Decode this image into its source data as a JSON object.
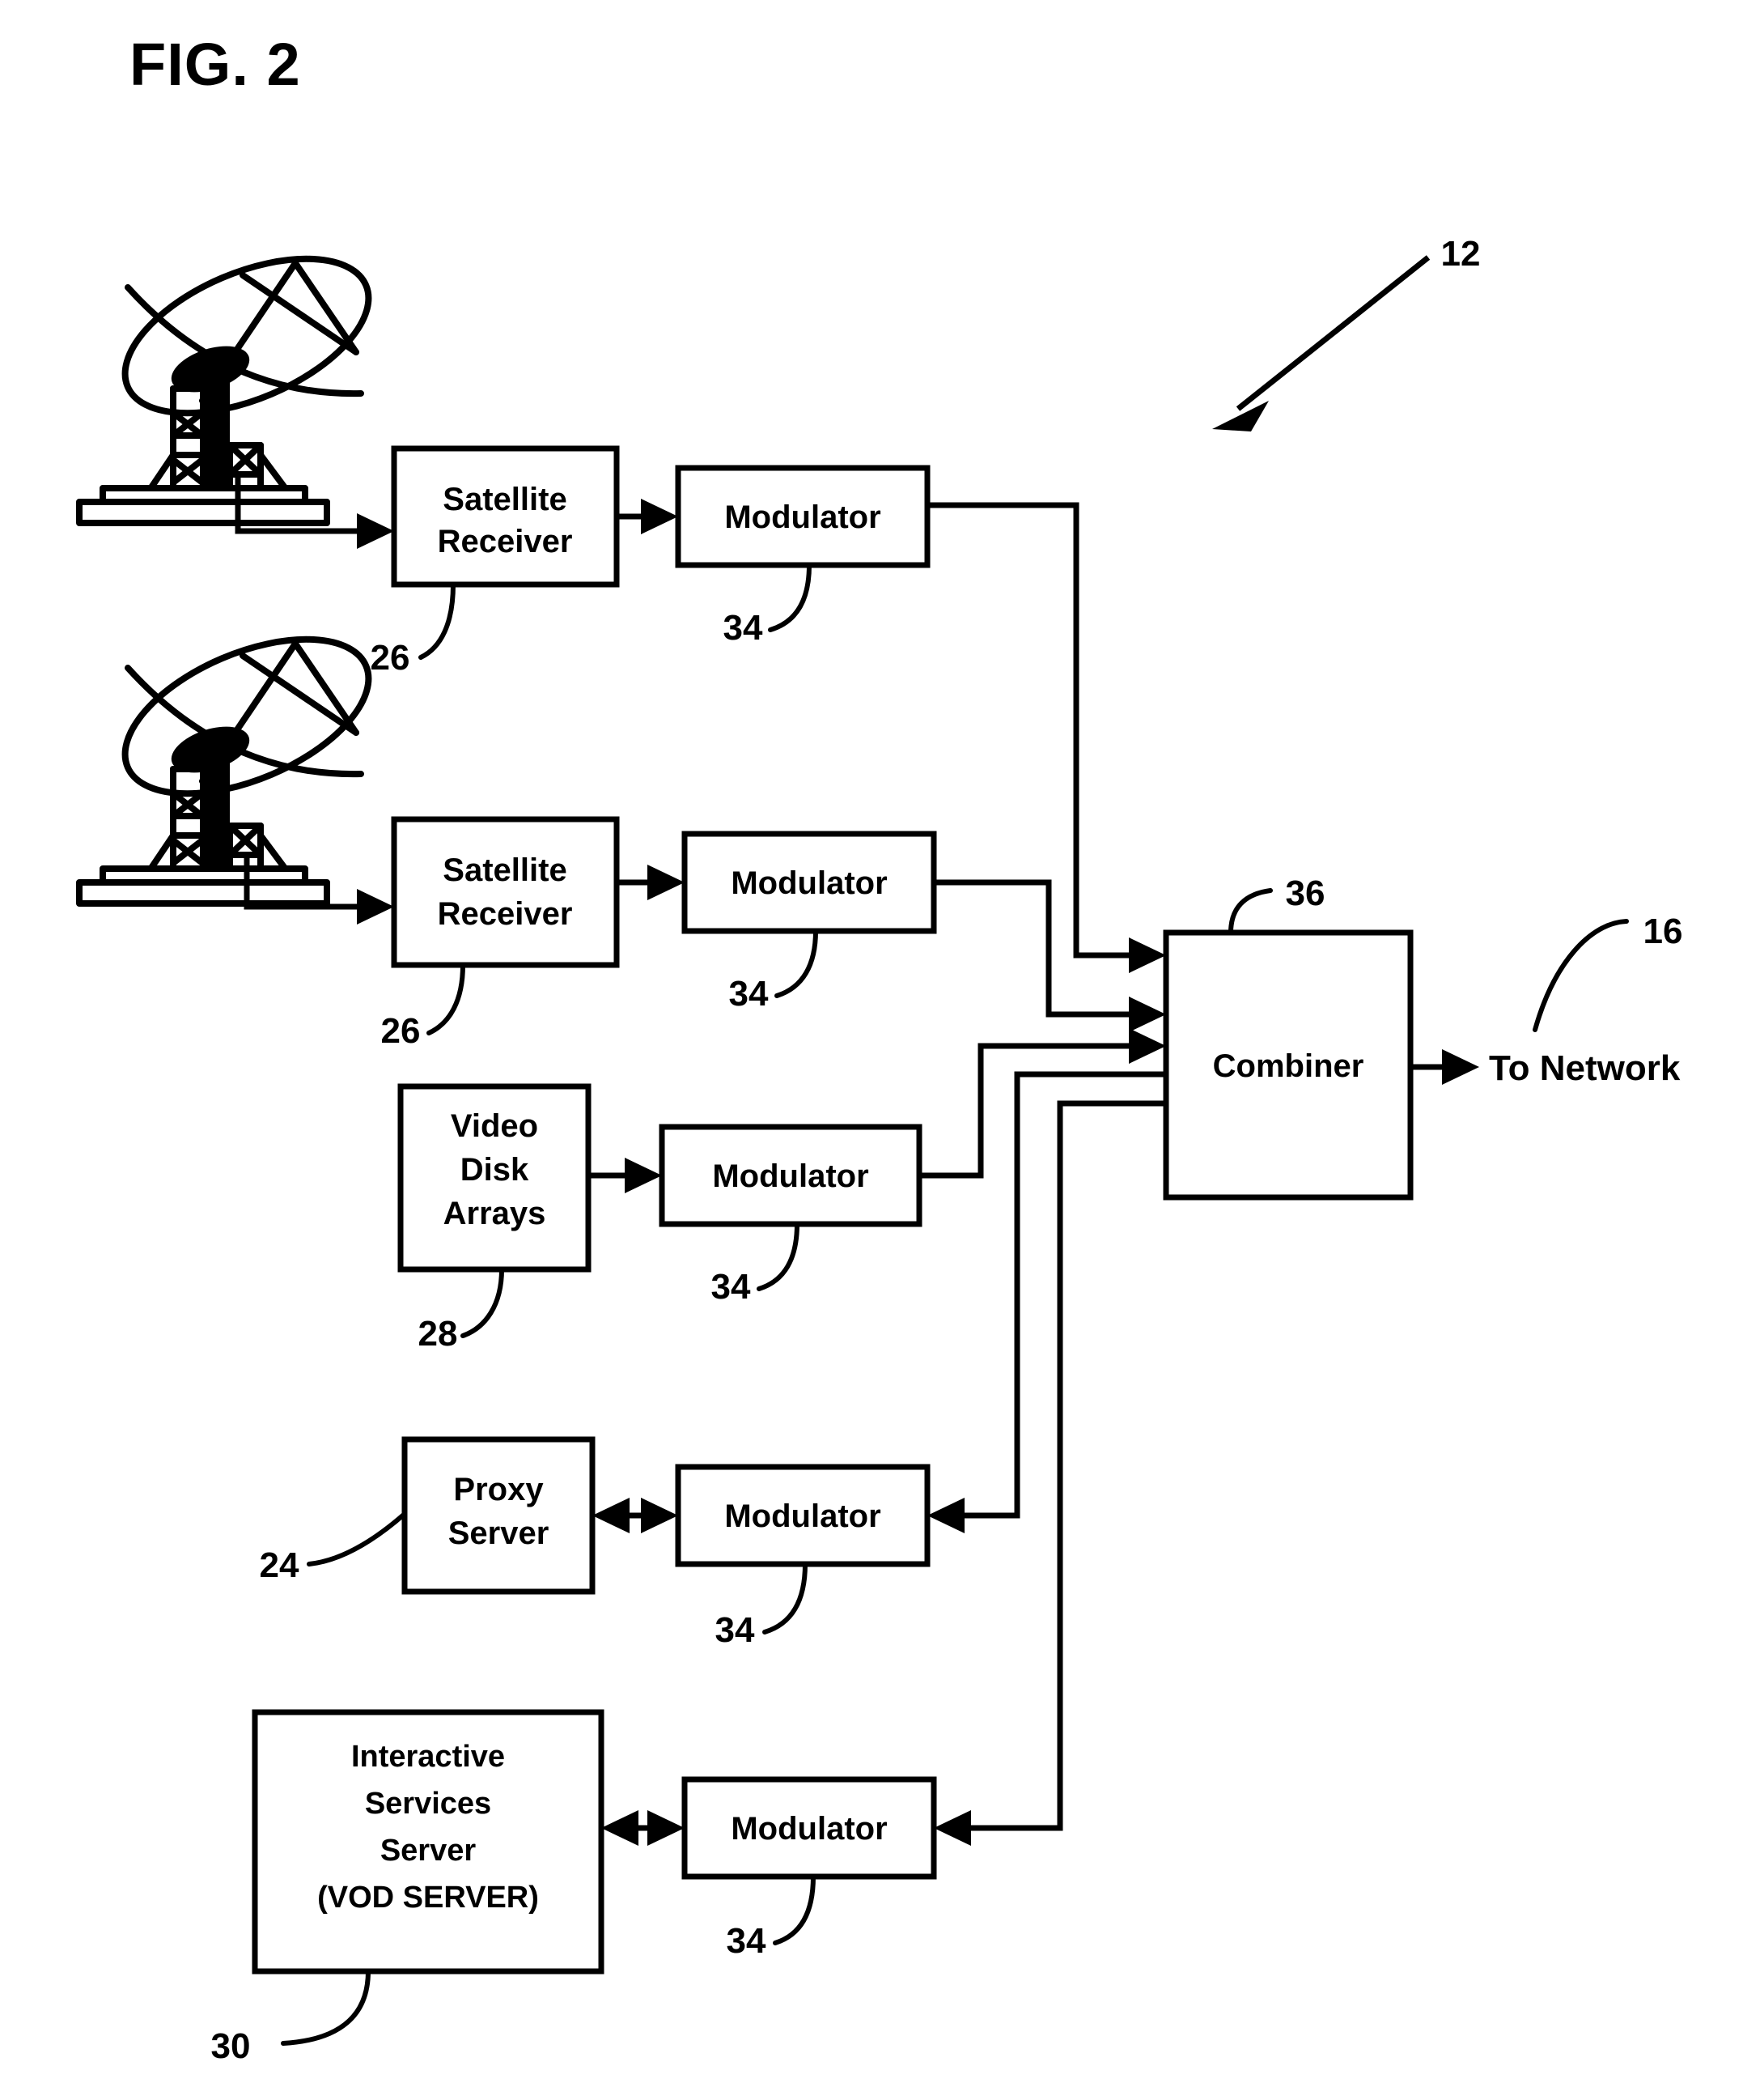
{
  "figure": {
    "title": "FIG. 2",
    "type": "patent-block-diagram",
    "overall_ref": "12",
    "output_ref": "16",
    "output_label": "To Network"
  },
  "blocks": {
    "satellite_receiver_1": {
      "label_line1": "Satellite",
      "label_line2": "Receiver",
      "ref": "26"
    },
    "satellite_receiver_2": {
      "label_line1": "Satellite",
      "label_line2": "Receiver",
      "ref": "26"
    },
    "video_disk_arrays": {
      "label_line1": "Video",
      "label_line2": "Disk",
      "label_line3": "Arrays",
      "ref": "28"
    },
    "proxy_server": {
      "label_line1": "Proxy",
      "label_line2": "Server",
      "ref": "24"
    },
    "interactive_services_server": {
      "label_line1": "Interactive",
      "label_line2": "Services",
      "label_line3": "Server",
      "label_line4": "(VOD SERVER)",
      "ref": "30"
    },
    "combiner": {
      "label": "Combiner",
      "ref": "36"
    },
    "modulator_1": {
      "label": "Modulator",
      "ref": "34"
    },
    "modulator_2": {
      "label": "Modulator",
      "ref": "34"
    },
    "modulator_3": {
      "label": "Modulator",
      "ref": "34"
    },
    "modulator_4": {
      "label": "Modulator",
      "ref": "34"
    },
    "modulator_5": {
      "label": "Modulator",
      "ref": "34"
    }
  },
  "antennas": {
    "dish_1": {
      "name": "satellite-dish"
    },
    "dish_2": {
      "name": "satellite-dish"
    }
  },
  "colors": {
    "ink": "#000000",
    "paper": "#ffffff"
  }
}
